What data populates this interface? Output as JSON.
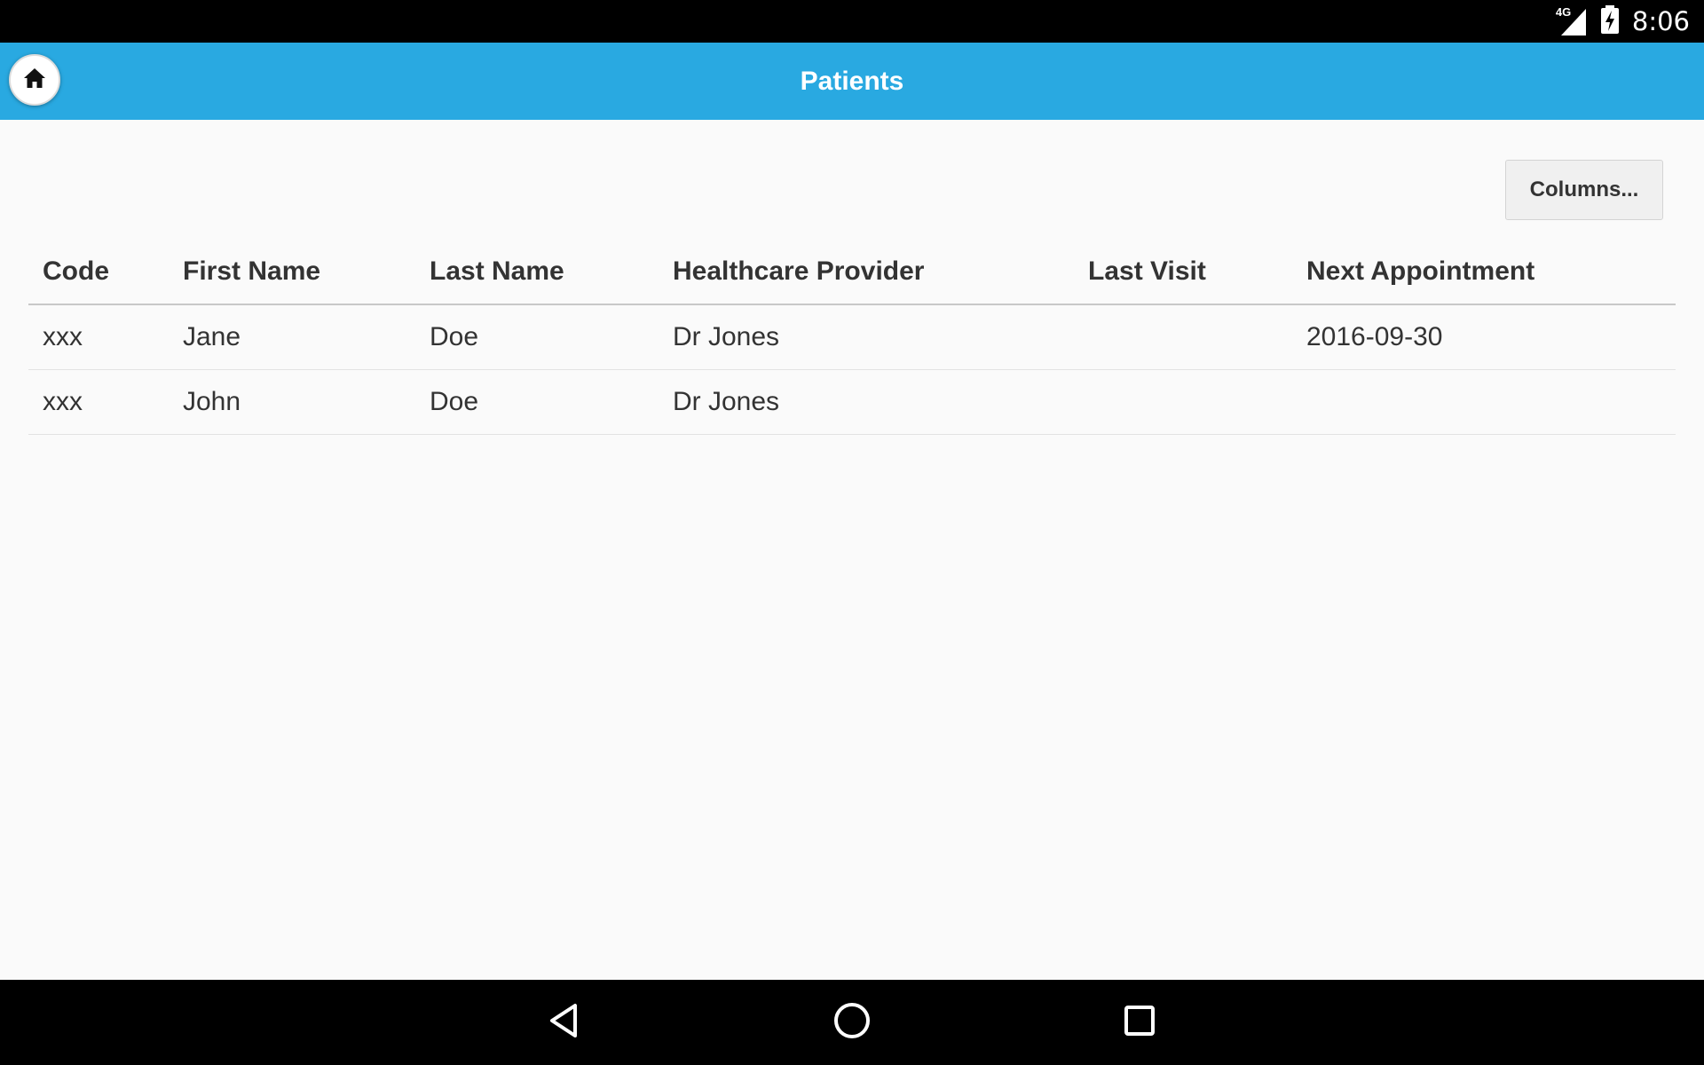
{
  "status_bar": {
    "time": "8:06",
    "network": "4G",
    "icons": [
      "signal-icon",
      "battery-charging-icon"
    ]
  },
  "header": {
    "title": "Patients",
    "home_icon": "home-icon",
    "color": "#29a9e1"
  },
  "toolbar": {
    "columns_label": "Columns..."
  },
  "table": {
    "columns": [
      "Code",
      "First Name",
      "Last Name",
      "Healthcare Provider",
      "Last Visit",
      "Next Appointment"
    ],
    "rows": [
      [
        "xxx",
        "Jane",
        "Doe",
        "Dr Jones",
        "",
        "2016-09-30"
      ],
      [
        "xxx",
        "John",
        "Doe",
        "Dr Jones",
        "",
        ""
      ]
    ]
  },
  "nav_bar": {
    "buttons": [
      "back-icon",
      "home-circle-icon",
      "recents-icon"
    ]
  }
}
